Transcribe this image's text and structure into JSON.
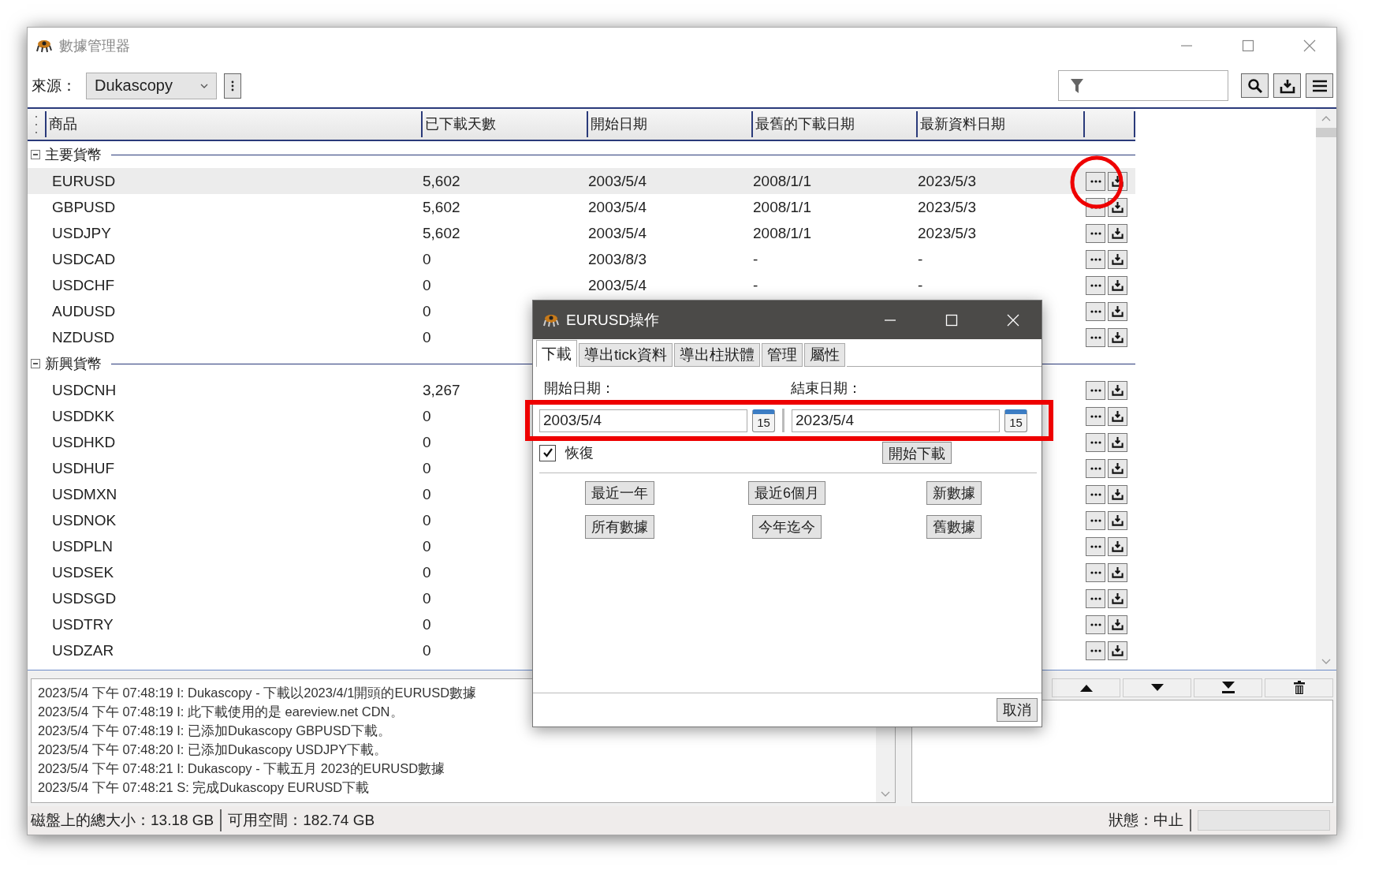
{
  "window": {
    "title": "數據管理器"
  },
  "source": {
    "label": "來源：",
    "value": "Dukascopy"
  },
  "table": {
    "columns": [
      "商品",
      "已下載天數",
      "開始日期",
      "最舊的下載日期",
      "最新資料日期"
    ],
    "groups": [
      {
        "label": "主要貨幣",
        "expanded": true,
        "rows": [
          {
            "symbol": "EURUSD",
            "days": "5,602",
            "start": "2003/5/4",
            "oldest": "2008/1/1",
            "newest": "2023/5/3",
            "selected": true
          },
          {
            "symbol": "GBPUSD",
            "days": "5,602",
            "start": "2003/5/4",
            "oldest": "2008/1/1",
            "newest": "2023/5/3",
            "selected": false
          },
          {
            "symbol": "USDJPY",
            "days": "5,602",
            "start": "2003/5/4",
            "oldest": "2008/1/1",
            "newest": "2023/5/3",
            "selected": false
          },
          {
            "symbol": "USDCAD",
            "days": "0",
            "start": "2003/8/3",
            "oldest": "-",
            "newest": "-",
            "selected": false
          },
          {
            "symbol": "USDCHF",
            "days": "0",
            "start": "2003/5/4",
            "oldest": "-",
            "newest": "-",
            "selected": false
          },
          {
            "symbol": "AUDUSD",
            "days": "0",
            "selected": false
          },
          {
            "symbol": "NZDUSD",
            "days": "0",
            "selected": false
          }
        ]
      },
      {
        "label": "新興貨幣",
        "expanded": true,
        "rows": [
          {
            "symbol": "USDCNH",
            "days": "3,267",
            "selected": false
          },
          {
            "symbol": "USDDKK",
            "days": "0",
            "selected": false
          },
          {
            "symbol": "USDHKD",
            "days": "0",
            "selected": false
          },
          {
            "symbol": "USDHUF",
            "days": "0",
            "selected": false
          },
          {
            "symbol": "USDMXN",
            "days": "0",
            "selected": false
          },
          {
            "symbol": "USDNOK",
            "days": "0",
            "selected": false
          },
          {
            "symbol": "USDPLN",
            "days": "0",
            "selected": false
          },
          {
            "symbol": "USDSEK",
            "days": "0",
            "selected": false
          },
          {
            "symbol": "USDSGD",
            "days": "0",
            "selected": false
          },
          {
            "symbol": "USDTRY",
            "days": "0",
            "selected": false
          },
          {
            "symbol": "USDZAR",
            "days": "0",
            "selected": false
          }
        ]
      }
    ]
  },
  "log": {
    "lines": [
      "2023/5/4 下午 07:48:19  I: Dukascopy - 下載以2023/4/1開頭的EURUSD數據",
      "2023/5/4 下午 07:48:19  I: 此下載使用的是 eareview.net CDN。",
      "2023/5/4 下午 07:48:19  I: 已添加Dukascopy GBPUSD下載。",
      "2023/5/4 下午 07:48:20  I: 已添加Dukascopy USDJPY下載。",
      "2023/5/4 下午 07:48:21  I: Dukascopy - 下載五月 2023的EURUSD數據",
      "2023/5/4 下午 07:48:21  S: 完成Dukascopy EURUSD下載"
    ]
  },
  "status_bar": {
    "disk_total": "磁盤上的總大小：13.18 GB",
    "free_space": "可用空間：182.74 GB",
    "state": "狀態：中止"
  },
  "dialog": {
    "title": "EURUSD操作",
    "tabs": [
      {
        "label": "下載",
        "selected": true
      },
      {
        "label": "導出tick資料",
        "selected": false
      },
      {
        "label": "導出柱狀體",
        "selected": false
      },
      {
        "label": "管理",
        "selected": false
      },
      {
        "label": "屬性",
        "selected": false
      }
    ],
    "dates": [
      {
        "label": "開始日期：",
        "value": "2003/5/4",
        "calendar_day": "15"
      },
      {
        "label": "結束日期：",
        "value": "2023/5/4",
        "calendar_day": "15"
      }
    ],
    "resume": {
      "label": "恢復",
      "checked": true
    },
    "start_button": "開始下載",
    "presets": [
      "最近一年",
      "最近6個月",
      "新數據",
      "所有數據",
      "今年迄今",
      "舊數據"
    ],
    "cancel": "取消"
  }
}
